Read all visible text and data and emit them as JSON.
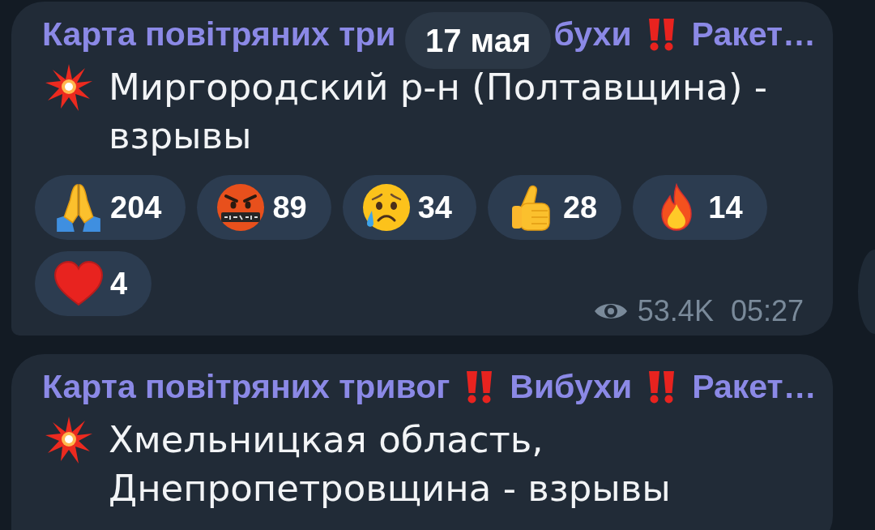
{
  "date_header": "17 мая",
  "messages": [
    {
      "title": [
        {
          "kind": "text",
          "text": "Карта повітряних три"
        },
        {
          "kind": "covered"
        },
        {
          "kind": "text",
          "text": "бухи"
        },
        {
          "kind": "mark"
        },
        {
          "kind": "text",
          "text": "Ракет…"
        }
      ],
      "text": "Миргородский р-н (Полтавщина) - взрывы",
      "reactions": [
        {
          "kind": "folded_hands",
          "count": "204"
        },
        {
          "kind": "swearing_face",
          "count": "89"
        },
        {
          "kind": "crying_face",
          "count": "34"
        },
        {
          "kind": "thumbs_up",
          "count": "28"
        },
        {
          "kind": "fire",
          "count": "14"
        },
        {
          "kind": "heart",
          "count": "4"
        }
      ],
      "views": "53.4K",
      "time": "05:27",
      "side_button": true
    },
    {
      "title": [
        {
          "kind": "text",
          "text": "Карта повітряних тривог"
        },
        {
          "kind": "mark"
        },
        {
          "kind": "text",
          "text": "Вибухи"
        },
        {
          "kind": "mark"
        },
        {
          "kind": "text",
          "text": "Ракет…"
        }
      ],
      "text": "Хмельницкая область, Днепропетровщина - взрывы"
    }
  ]
}
